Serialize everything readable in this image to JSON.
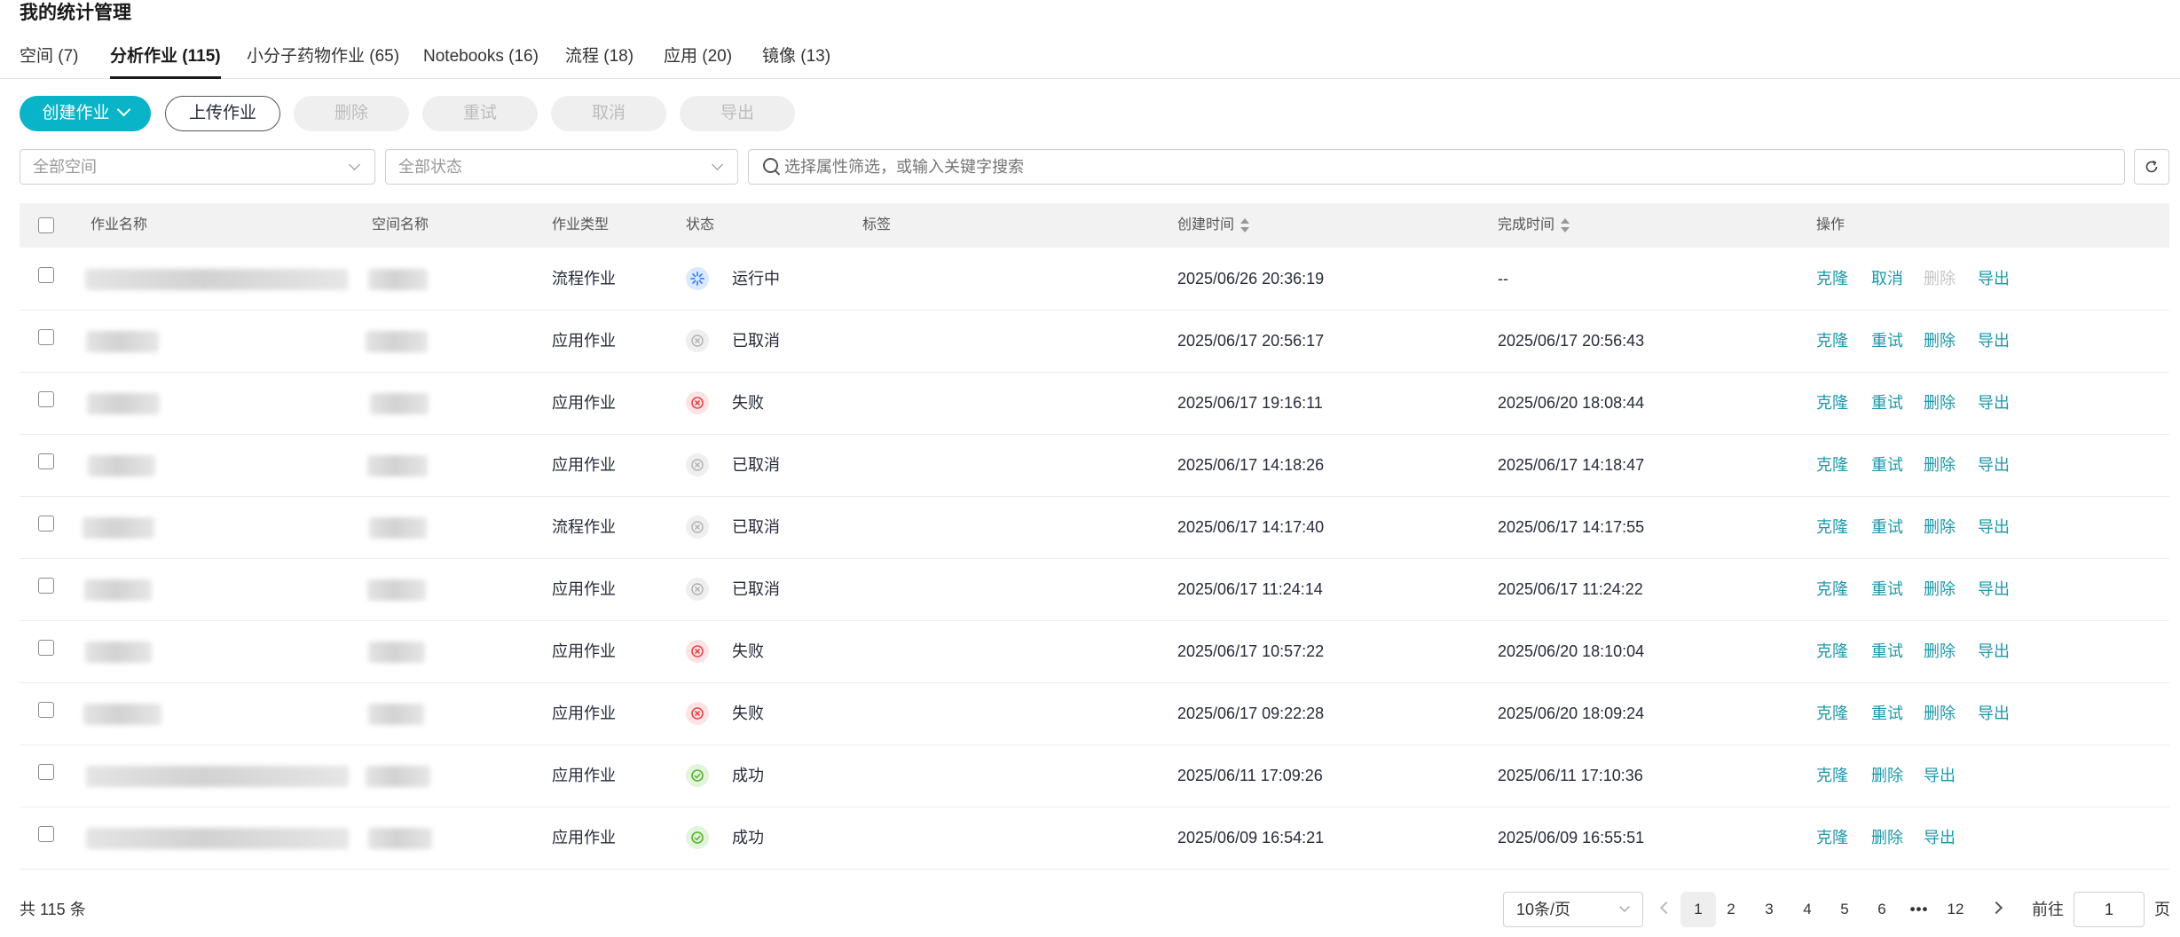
{
  "page_title": "我的统计管理",
  "tabs": [
    {
      "label": "空间 (7)"
    },
    {
      "label": "分析作业 (115)"
    },
    {
      "label": "小分子药物作业 (65)"
    },
    {
      "label": "Notebooks (16)"
    },
    {
      "label": "流程 (18)"
    },
    {
      "label": "应用 (20)"
    },
    {
      "label": "镜像 (13)"
    }
  ],
  "toolbar": {
    "create": "创建作业",
    "upload": "上传作业",
    "delete": "删除",
    "retry": "重试",
    "cancel": "取消",
    "export": "导出"
  },
  "filters": {
    "space_placeholder": "全部空间",
    "status_placeholder": "全部状态",
    "search_placeholder": "选择属性筛选，或输入关键字搜索"
  },
  "columns": {
    "name": "作业名称",
    "space": "空间名称",
    "type": "作业类型",
    "status": "状态",
    "tags": "标签",
    "created": "创建时间",
    "finished": "完成时间",
    "actions": "操作"
  },
  "rows": [
    {
      "type": "流程作业",
      "status": "运行中",
      "status_kind": "running",
      "created": "2025/06/26 20:36:19",
      "finished": "--",
      "ops": [
        "克隆",
        "取消",
        "删除",
        "导出"
      ],
      "ops_disabled": [
        false,
        false,
        true,
        false
      ]
    },
    {
      "type": "应用作业",
      "status": "已取消",
      "status_kind": "cancelled",
      "created": "2025/06/17 20:56:17",
      "finished": "2025/06/17 20:56:43",
      "ops": [
        "克隆",
        "重试",
        "删除",
        "导出"
      ],
      "ops_disabled": [
        false,
        false,
        false,
        false
      ]
    },
    {
      "type": "应用作业",
      "status": "失败",
      "status_kind": "failed",
      "created": "2025/06/17 19:16:11",
      "finished": "2025/06/20 18:08:44",
      "ops": [
        "克隆",
        "重试",
        "删除",
        "导出"
      ],
      "ops_disabled": [
        false,
        false,
        false,
        false
      ]
    },
    {
      "type": "应用作业",
      "status": "已取消",
      "status_kind": "cancelled",
      "created": "2025/06/17 14:18:26",
      "finished": "2025/06/17 14:18:47",
      "ops": [
        "克隆",
        "重试",
        "删除",
        "导出"
      ],
      "ops_disabled": [
        false,
        false,
        false,
        false
      ]
    },
    {
      "type": "流程作业",
      "status": "已取消",
      "status_kind": "cancelled",
      "created": "2025/06/17 14:17:40",
      "finished": "2025/06/17 14:17:55",
      "ops": [
        "克隆",
        "重试",
        "删除",
        "导出"
      ],
      "ops_disabled": [
        false,
        false,
        false,
        false
      ]
    },
    {
      "type": "应用作业",
      "status": "已取消",
      "status_kind": "cancelled",
      "created": "2025/06/17 11:24:14",
      "finished": "2025/06/17 11:24:22",
      "ops": [
        "克隆",
        "重试",
        "删除",
        "导出"
      ],
      "ops_disabled": [
        false,
        false,
        false,
        false
      ]
    },
    {
      "type": "应用作业",
      "status": "失败",
      "status_kind": "failed",
      "created": "2025/06/17 10:57:22",
      "finished": "2025/06/20 18:10:04",
      "ops": [
        "克隆",
        "重试",
        "删除",
        "导出"
      ],
      "ops_disabled": [
        false,
        false,
        false,
        false
      ]
    },
    {
      "type": "应用作业",
      "status": "失败",
      "status_kind": "failed",
      "created": "2025/06/17 09:22:28",
      "finished": "2025/06/20 18:09:24",
      "ops": [
        "克隆",
        "重试",
        "删除",
        "导出"
      ],
      "ops_disabled": [
        false,
        false,
        false,
        false
      ]
    },
    {
      "type": "应用作业",
      "status": "成功",
      "status_kind": "success",
      "created": "2025/06/11 17:09:26",
      "finished": "2025/06/11 17:10:36",
      "ops": [
        "克隆",
        "删除",
        "导出"
      ],
      "ops_disabled": [
        false,
        false,
        false
      ]
    },
    {
      "type": "应用作业",
      "status": "成功",
      "status_kind": "success",
      "created": "2025/06/09 16:54:21",
      "finished": "2025/06/09 16:55:51",
      "ops": [
        "克隆",
        "删除",
        "导出"
      ],
      "ops_disabled": [
        false,
        false,
        false
      ]
    }
  ],
  "pagination": {
    "total": "共 115 条",
    "page_size": "10条/页",
    "pages": [
      "1",
      "2",
      "3",
      "4",
      "5",
      "6",
      "•••",
      "12"
    ],
    "current": "1",
    "goto_label": "前往",
    "goto_value": "1",
    "goto_suffix": "页"
  },
  "colors": {
    "primary": "#0ab4c8",
    "link": "#1d97aa",
    "failed": "#e5484d",
    "success": "#52b52a",
    "running": "#3b82f6",
    "cancelled": "#b0b0b0"
  }
}
